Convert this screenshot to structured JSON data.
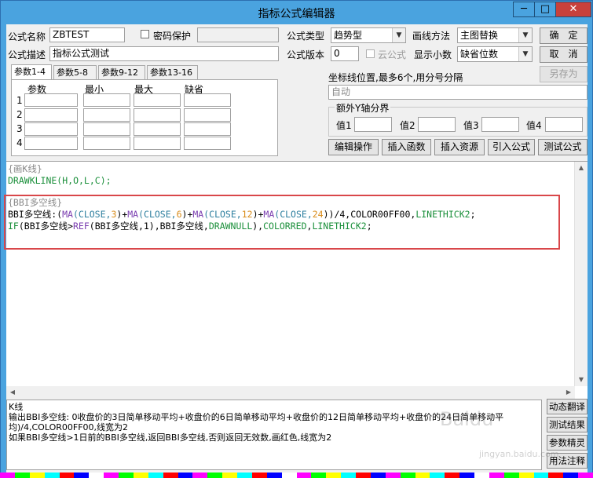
{
  "window": {
    "title": "指标公式编辑器",
    "minimize": "─",
    "maximize": "□",
    "close": "✕"
  },
  "form": {
    "name_label": "公式名称",
    "name_value": "ZBTEST",
    "password_label": "密码保护",
    "type_label": "公式类型",
    "type_value": "趋势型",
    "draw_label": "画线方法",
    "draw_value": "主图替换",
    "ok": "确　定",
    "desc_label": "公式描述",
    "desc_value": "指标公式测试",
    "version_label": "公式版本",
    "version_value": "0",
    "cloud_label": "云公式",
    "decimals_label": "显示小数",
    "decimals_value": "缺省位数",
    "cancel": "取　消",
    "save_as": "另存为"
  },
  "tabs": [
    "参数1-4",
    "参数5-8",
    "参数9-12",
    "参数13-16"
  ],
  "params": {
    "headers": [
      "参数",
      "最小",
      "最大",
      "缺省"
    ],
    "rows": [
      "1",
      "2",
      "3",
      "4"
    ]
  },
  "coords": {
    "label": "坐标线位置,最多6个,用分号分隔",
    "value": "自动"
  },
  "yaxis": {
    "title": "额外Y轴分界",
    "labels": [
      "值1",
      "值2",
      "值3",
      "值4"
    ]
  },
  "actions": [
    "编辑操作",
    "插入函数",
    "插入资源",
    "引入公式",
    "测试公式"
  ],
  "code": {
    "l1": "{画K线}",
    "l2": "DRAWKLINE(H,O,L,C);",
    "l4": "{BBI多空线}",
    "l5": [
      {
        "t": "BBI多空线:(",
        "c": "#000000"
      },
      {
        "t": "MA",
        "c": "#7b3fb0"
      },
      {
        "t": "(CLOSE,",
        "c": "#2e7f9f"
      },
      {
        "t": "3",
        "c": "#d98c1a"
      },
      {
        "t": ")+",
        "c": "#000000"
      },
      {
        "t": "MA",
        "c": "#7b3fb0"
      },
      {
        "t": "(CLOSE,",
        "c": "#2e7f9f"
      },
      {
        "t": "6",
        "c": "#d98c1a"
      },
      {
        "t": ")+",
        "c": "#000000"
      },
      {
        "t": "MA",
        "c": "#7b3fb0"
      },
      {
        "t": "(CLOSE,",
        "c": "#2e7f9f"
      },
      {
        "t": "12",
        "c": "#d98c1a"
      },
      {
        "t": ")+",
        "c": "#000000"
      },
      {
        "t": "MA",
        "c": "#7b3fb0"
      },
      {
        "t": "(CLOSE,",
        "c": "#2e7f9f"
      },
      {
        "t": "24",
        "c": "#d98c1a"
      },
      {
        "t": "))/4,COLOR00FF00,",
        "c": "#000000"
      },
      {
        "t": "LINETHICK2",
        "c": "#1a8f3a"
      },
      {
        "t": ";",
        "c": "#000000"
      }
    ],
    "l6": [
      {
        "t": "IF",
        "c": "#1a8f3a"
      },
      {
        "t": "(BBI多空线>",
        "c": "#000000"
      },
      {
        "t": "REF",
        "c": "#7b3fb0"
      },
      {
        "t": "(BBI多空线,1),BBI多空线,",
        "c": "#000000"
      },
      {
        "t": "DRAWNULL",
        "c": "#1a8f3a"
      },
      {
        "t": "),",
        "c": "#000000"
      },
      {
        "t": "COLORRED",
        "c": "#1a8f3a"
      },
      {
        "t": ",",
        "c": "#000000"
      },
      {
        "t": "LINETHICK2",
        "c": "#1a8f3a"
      },
      {
        "t": ";",
        "c": "#000000"
      }
    ]
  },
  "notes": {
    "n1": "K线",
    "n2": "输出BBI多空线: 0收盘价的3日简单移动平均+收盘价的6日简单移动平均+收盘价的12日简单移动平均+收盘价的24日简单移动平",
    "n3": "均)/4,COLOR00FF00,线宽为2",
    "n4": "如果BBI多空线>1日前的BBI多空线,返回BBI多空线,否则返回无效数,画红色,线宽为2"
  },
  "side": [
    "动态翻译",
    "测试结果",
    "参数精灵",
    "用法注释"
  ],
  "watermark": "Baidu",
  "watermark_url": "jingyan.baidu.com",
  "colors": {
    "accent": "#4aa3df",
    "highlight": "#d9474a",
    "strip": [
      "#ff00ff",
      "#00ff00",
      "#ffff00",
      "#00ffff",
      "#ff0000",
      "#0000ff",
      "#ffffff",
      "#ff00ff",
      "#00ff00",
      "#ffff00",
      "#00ffff",
      "#ff0000",
      "#0000ff",
      "#ff00ff",
      "#00ff00",
      "#ffff00",
      "#00ffff",
      "#ff0000",
      "#0000ff",
      "#ffffff",
      "#ff00ff",
      "#00ff00",
      "#ffff00",
      "#00ffff",
      "#ff0000",
      "#0000ff",
      "#ff00ff",
      "#00ff00",
      "#ffff00",
      "#00ffff",
      "#ff0000",
      "#0000ff",
      "#ffffff",
      "#ff00ff",
      "#00ff00",
      "#ffff00",
      "#00ffff",
      "#ff0000",
      "#0000ff",
      "#ff00ff"
    ]
  }
}
